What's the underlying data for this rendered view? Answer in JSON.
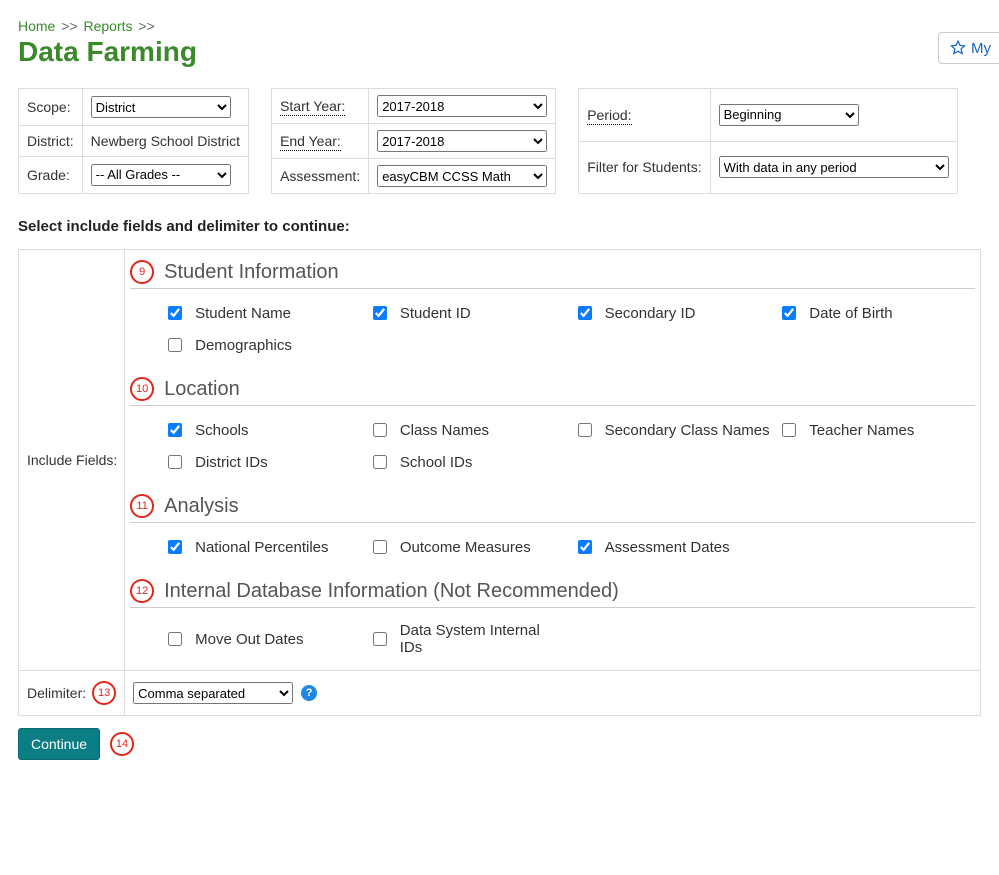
{
  "breadcrumb": {
    "home": "Home",
    "reports": "Reports"
  },
  "page_title": "Data Farming",
  "my_button_label": "My",
  "filters": {
    "scope": {
      "label": "Scope:",
      "value": "District"
    },
    "district": {
      "label": "District:",
      "value": "Newberg School District"
    },
    "grade": {
      "label": "Grade:",
      "value": "-- All Grades --"
    },
    "start_year": {
      "label": "Start Year:",
      "value": "2017-2018"
    },
    "end_year": {
      "label": "End Year:",
      "value": "2017-2018"
    },
    "assessment": {
      "label": "Assessment:",
      "value": "easyCBM CCSS Math"
    },
    "period": {
      "label": "Period:",
      "value": "Beginning"
    },
    "filter_students": {
      "label": "Filter for Students:",
      "value": "With data in any period"
    }
  },
  "section_prompt": "Select include fields and delimiter to continue:",
  "side_label": "Include Fields:",
  "sections": {
    "s9": {
      "badge": "9",
      "title": "Student Information",
      "fields": [
        {
          "label": "Student Name",
          "checked": true
        },
        {
          "label": "Student ID",
          "checked": true
        },
        {
          "label": "Secondary ID",
          "checked": true
        },
        {
          "label": "Date of Birth",
          "checked": true
        },
        {
          "label": "Demographics",
          "checked": false
        }
      ]
    },
    "s10": {
      "badge": "10",
      "title": "Location",
      "fields": [
        {
          "label": "Schools",
          "checked": true
        },
        {
          "label": "Class Names",
          "checked": false
        },
        {
          "label": "Secondary Class Names",
          "checked": false
        },
        {
          "label": "Teacher Names",
          "checked": false
        },
        {
          "label": "District IDs",
          "checked": false
        },
        {
          "label": "School IDs",
          "checked": false
        }
      ]
    },
    "s11": {
      "badge": "11",
      "title": "Analysis",
      "fields": [
        {
          "label": "National Percentiles",
          "checked": true
        },
        {
          "label": "Outcome Measures",
          "checked": false
        },
        {
          "label": "Assessment Dates",
          "checked": true
        }
      ]
    },
    "s12": {
      "badge": "12",
      "title": "Internal Database Information (Not Recommended)",
      "fields": [
        {
          "label": "Move Out Dates",
          "checked": false
        },
        {
          "label": "Data System Internal IDs",
          "checked": false
        }
      ]
    }
  },
  "delimiter": {
    "label": "Delimiter:",
    "badge": "13",
    "value": "Comma separated"
  },
  "continue": {
    "label": "Continue",
    "badge": "14"
  }
}
